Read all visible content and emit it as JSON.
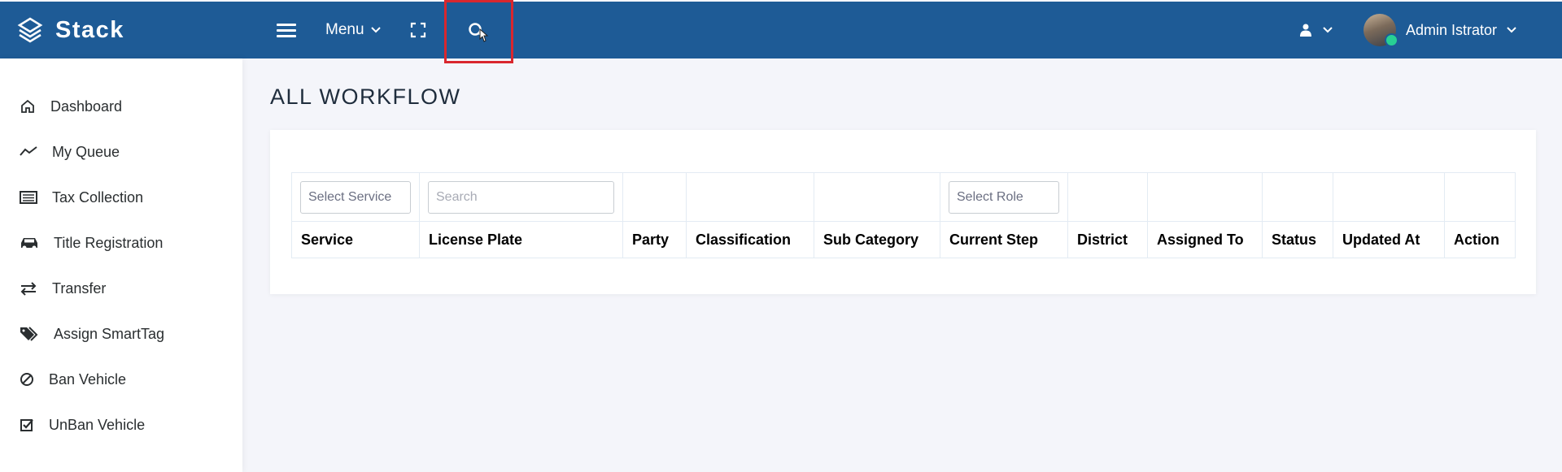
{
  "brand": {
    "name": "Stack"
  },
  "navbar": {
    "menu_label": "Menu",
    "profile_name": "Admin Istrator"
  },
  "sidebar": {
    "items": [
      {
        "label": "Dashboard",
        "icon": "home-icon"
      },
      {
        "label": "My Queue",
        "icon": "trend-line-icon"
      },
      {
        "label": "Tax Collection",
        "icon": "list-card-icon"
      },
      {
        "label": "Title Registration",
        "icon": "car-icon"
      },
      {
        "label": "Transfer",
        "icon": "exchange-arrows-icon"
      },
      {
        "label": "Assign SmartTag",
        "icon": "tags-icon"
      },
      {
        "label": "Ban Vehicle",
        "icon": "ban-icon"
      },
      {
        "label": "UnBan Vehicle",
        "icon": "check-square-icon"
      }
    ]
  },
  "main": {
    "title": "ALL WORKFLOW",
    "filters": {
      "service_placeholder": "Select Service",
      "search_placeholder": "Search",
      "role_placeholder": "Select Role"
    },
    "table": {
      "columns": [
        "Service",
        "License Plate",
        "Party",
        "Classification",
        "Sub Category",
        "Current Step",
        "District",
        "Assigned To",
        "Status",
        "Updated At",
        "Action"
      ]
    }
  },
  "colors": {
    "navbar": "#1e5b96",
    "highlight": "#d9272e",
    "online": "#28d094"
  }
}
